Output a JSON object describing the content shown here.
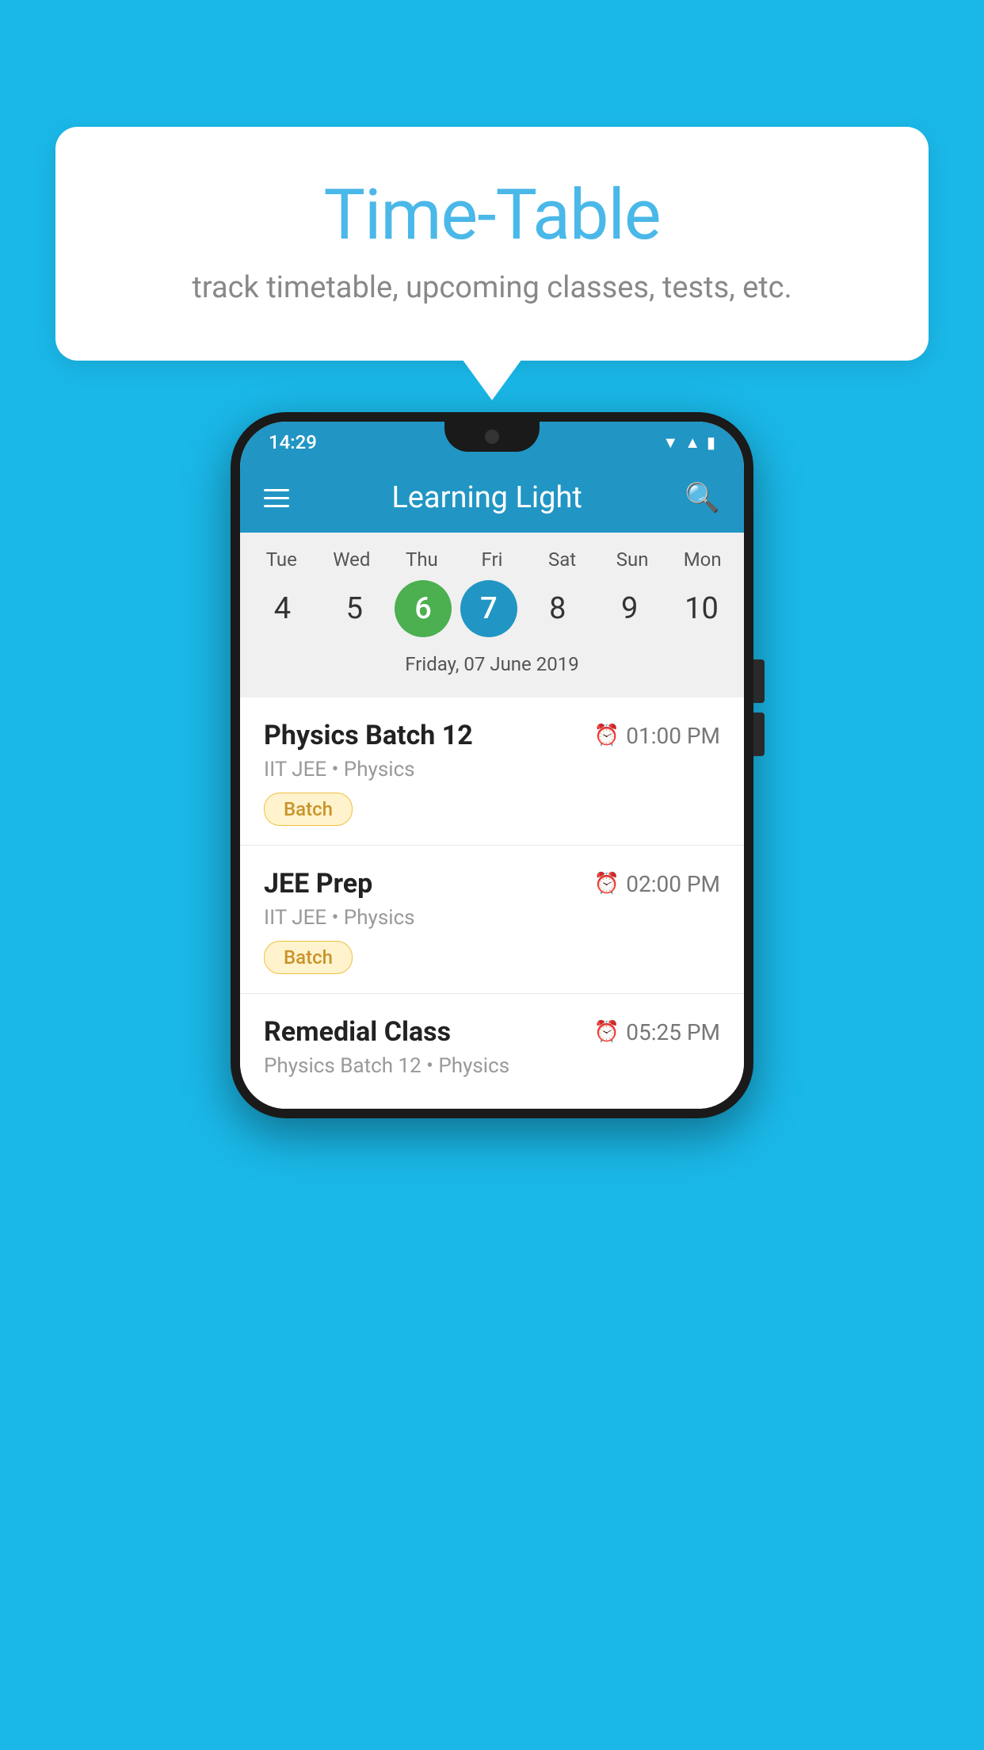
{
  "background_color": "#1ab8e8",
  "bubble": {
    "title": "Time-Table",
    "subtitle": "track timetable, upcoming classes, tests, etc."
  },
  "phone": {
    "status_bar": {
      "time": "14:29"
    },
    "header": {
      "title": "Learning Light"
    },
    "calendar": {
      "days": [
        {
          "label": "Tue",
          "number": "4"
        },
        {
          "label": "Wed",
          "number": "5"
        },
        {
          "label": "Thu",
          "number": "6",
          "state": "today"
        },
        {
          "label": "Fri",
          "number": "7",
          "state": "selected"
        },
        {
          "label": "Sat",
          "number": "8"
        },
        {
          "label": "Sun",
          "number": "9"
        },
        {
          "label": "Mon",
          "number": "10"
        }
      ],
      "selected_date": "Friday, 07 June 2019"
    },
    "classes": [
      {
        "name": "Physics Batch 12",
        "time": "01:00 PM",
        "meta": "IIT JEE • Physics",
        "tag": "Batch"
      },
      {
        "name": "JEE Prep",
        "time": "02:00 PM",
        "meta": "IIT JEE • Physics",
        "tag": "Batch"
      },
      {
        "name": "Remedial Class",
        "time": "05:25 PM",
        "meta": "Physics Batch 12 • Physics",
        "tag": ""
      }
    ]
  }
}
